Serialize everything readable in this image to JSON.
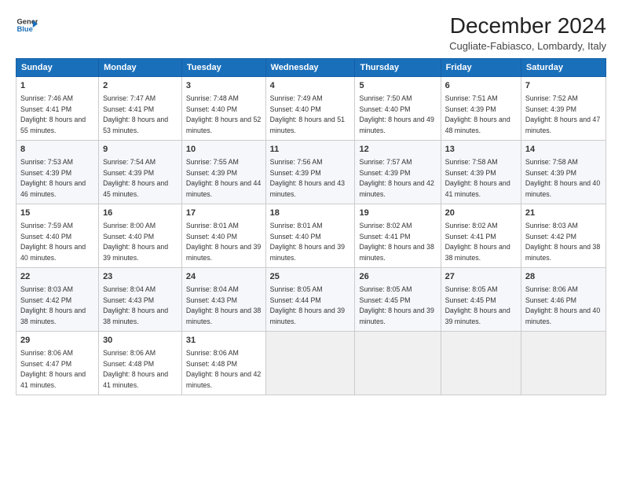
{
  "logo": {
    "line1": "General",
    "line2": "Blue",
    "arrow_color": "#1a6fba"
  },
  "title": "December 2024",
  "subtitle": "Cugliate-Fabiasco, Lombardy, Italy",
  "header_days": [
    "Sunday",
    "Monday",
    "Tuesday",
    "Wednesday",
    "Thursday",
    "Friday",
    "Saturday"
  ],
  "weeks": [
    [
      {
        "day": 1,
        "sunrise": "7:46 AM",
        "sunset": "4:41 PM",
        "daylight": "8 hours and 55 minutes."
      },
      {
        "day": 2,
        "sunrise": "7:47 AM",
        "sunset": "4:41 PM",
        "daylight": "8 hours and 53 minutes."
      },
      {
        "day": 3,
        "sunrise": "7:48 AM",
        "sunset": "4:40 PM",
        "daylight": "8 hours and 52 minutes."
      },
      {
        "day": 4,
        "sunrise": "7:49 AM",
        "sunset": "4:40 PM",
        "daylight": "8 hours and 51 minutes."
      },
      {
        "day": 5,
        "sunrise": "7:50 AM",
        "sunset": "4:40 PM",
        "daylight": "8 hours and 49 minutes."
      },
      {
        "day": 6,
        "sunrise": "7:51 AM",
        "sunset": "4:39 PM",
        "daylight": "8 hours and 48 minutes."
      },
      {
        "day": 7,
        "sunrise": "7:52 AM",
        "sunset": "4:39 PM",
        "daylight": "8 hours and 47 minutes."
      }
    ],
    [
      {
        "day": 8,
        "sunrise": "7:53 AM",
        "sunset": "4:39 PM",
        "daylight": "8 hours and 46 minutes."
      },
      {
        "day": 9,
        "sunrise": "7:54 AM",
        "sunset": "4:39 PM",
        "daylight": "8 hours and 45 minutes."
      },
      {
        "day": 10,
        "sunrise": "7:55 AM",
        "sunset": "4:39 PM",
        "daylight": "8 hours and 44 minutes."
      },
      {
        "day": 11,
        "sunrise": "7:56 AM",
        "sunset": "4:39 PM",
        "daylight": "8 hours and 43 minutes."
      },
      {
        "day": 12,
        "sunrise": "7:57 AM",
        "sunset": "4:39 PM",
        "daylight": "8 hours and 42 minutes."
      },
      {
        "day": 13,
        "sunrise": "7:58 AM",
        "sunset": "4:39 PM",
        "daylight": "8 hours and 41 minutes."
      },
      {
        "day": 14,
        "sunrise": "7:58 AM",
        "sunset": "4:39 PM",
        "daylight": "8 hours and 40 minutes."
      }
    ],
    [
      {
        "day": 15,
        "sunrise": "7:59 AM",
        "sunset": "4:40 PM",
        "daylight": "8 hours and 40 minutes."
      },
      {
        "day": 16,
        "sunrise": "8:00 AM",
        "sunset": "4:40 PM",
        "daylight": "8 hours and 39 minutes."
      },
      {
        "day": 17,
        "sunrise": "8:01 AM",
        "sunset": "4:40 PM",
        "daylight": "8 hours and 39 minutes."
      },
      {
        "day": 18,
        "sunrise": "8:01 AM",
        "sunset": "4:40 PM",
        "daylight": "8 hours and 39 minutes."
      },
      {
        "day": 19,
        "sunrise": "8:02 AM",
        "sunset": "4:41 PM",
        "daylight": "8 hours and 38 minutes."
      },
      {
        "day": 20,
        "sunrise": "8:02 AM",
        "sunset": "4:41 PM",
        "daylight": "8 hours and 38 minutes."
      },
      {
        "day": 21,
        "sunrise": "8:03 AM",
        "sunset": "4:42 PM",
        "daylight": "8 hours and 38 minutes."
      }
    ],
    [
      {
        "day": 22,
        "sunrise": "8:03 AM",
        "sunset": "4:42 PM",
        "daylight": "8 hours and 38 minutes."
      },
      {
        "day": 23,
        "sunrise": "8:04 AM",
        "sunset": "4:43 PM",
        "daylight": "8 hours and 38 minutes."
      },
      {
        "day": 24,
        "sunrise": "8:04 AM",
        "sunset": "4:43 PM",
        "daylight": "8 hours and 38 minutes."
      },
      {
        "day": 25,
        "sunrise": "8:05 AM",
        "sunset": "4:44 PM",
        "daylight": "8 hours and 39 minutes."
      },
      {
        "day": 26,
        "sunrise": "8:05 AM",
        "sunset": "4:45 PM",
        "daylight": "8 hours and 39 minutes."
      },
      {
        "day": 27,
        "sunrise": "8:05 AM",
        "sunset": "4:45 PM",
        "daylight": "8 hours and 39 minutes."
      },
      {
        "day": 28,
        "sunrise": "8:06 AM",
        "sunset": "4:46 PM",
        "daylight": "8 hours and 40 minutes."
      }
    ],
    [
      {
        "day": 29,
        "sunrise": "8:06 AM",
        "sunset": "4:47 PM",
        "daylight": "8 hours and 41 minutes."
      },
      {
        "day": 30,
        "sunrise": "8:06 AM",
        "sunset": "4:48 PM",
        "daylight": "8 hours and 41 minutes."
      },
      {
        "day": 31,
        "sunrise": "8:06 AM",
        "sunset": "4:48 PM",
        "daylight": "8 hours and 42 minutes."
      },
      null,
      null,
      null,
      null
    ]
  ],
  "colors": {
    "header_bg": "#1a6fba",
    "accent": "#1a6fba"
  }
}
